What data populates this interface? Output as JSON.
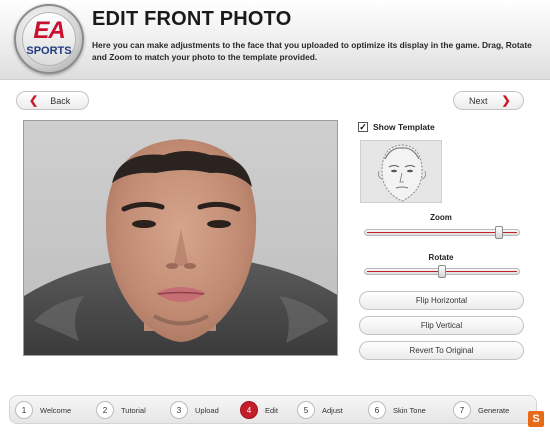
{
  "header": {
    "logo_ea": "EA",
    "logo_sports": "SPORTS",
    "title": "EDIT FRONT PHOTO",
    "description": "Here you can make adjustments to the face that you uploaded to optimize its display in the game. Drag, Rotate and Zoom to match your photo to the template provided."
  },
  "nav": {
    "back_label": "Back",
    "next_label": "Next"
  },
  "panel": {
    "show_template_label": "Show Template",
    "show_template_checked": "✓",
    "zoom_label": "Zoom",
    "zoom_level": 0.9,
    "rotate_label": "Rotate",
    "rotate_level": 0.5,
    "flip_horizontal_label": "Flip Horizontal",
    "flip_vertical_label": "Flip Vertical",
    "revert_label": "Revert To Original"
  },
  "steps": [
    {
      "num": "1",
      "label": "Welcome"
    },
    {
      "num": "2",
      "label": "Tutorial"
    },
    {
      "num": "3",
      "label": "Upload"
    },
    {
      "num": "4",
      "label": "Edit"
    },
    {
      "num": "5",
      "label": "Adjust"
    },
    {
      "num": "6",
      "label": "Skin Tone"
    },
    {
      "num": "7",
      "label": "Generate"
    }
  ],
  "active_step": "4",
  "colors": {
    "accent": "#c41e2a",
    "brand_blue": "#1f3b80"
  },
  "icons": {
    "back": "chevron-left-icon",
    "next": "chevron-right-icon",
    "corner": "s-logo-icon"
  },
  "corner_glyph": "S"
}
